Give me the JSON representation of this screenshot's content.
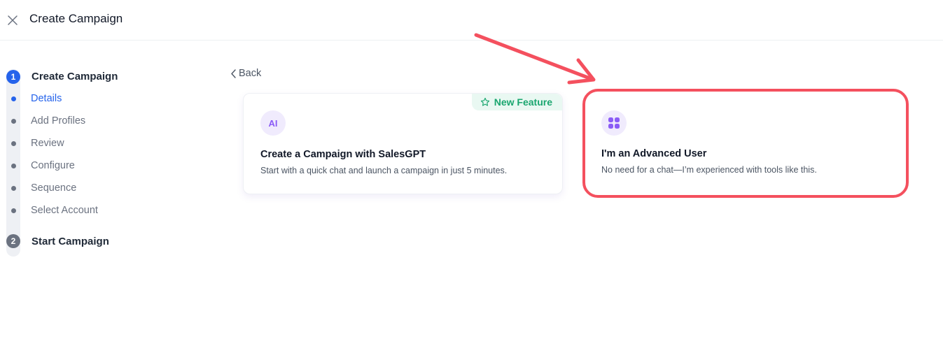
{
  "header": {
    "title": "Create Campaign",
    "close_icon": "close-icon"
  },
  "stepper": {
    "steps": [
      {
        "number": "1",
        "title": "Create Campaign"
      },
      {
        "number": "2",
        "title": "Start Campaign"
      }
    ],
    "substeps": [
      "Details",
      "Add Profiles",
      "Review",
      "Configure",
      "Sequence",
      "Select Account"
    ],
    "active_substep": "Details"
  },
  "back": {
    "label": "Back"
  },
  "cards": {
    "ai": {
      "badge": "New Feature",
      "icon_text": "AI",
      "title": "Create a Campaign with SalesGPT",
      "description": "Start with a quick chat and launch a campaign in just 5 minutes."
    },
    "advanced": {
      "icon": "grid-icon",
      "title": "I'm an Advanced User",
      "description": "No need for a chat—I’m experienced with tools like this."
    }
  },
  "colors": {
    "primary": "#2563eb",
    "accent_purple": "#8b5cf6",
    "badge_green": "#1aa66f",
    "annotation_red": "#f4505e"
  }
}
